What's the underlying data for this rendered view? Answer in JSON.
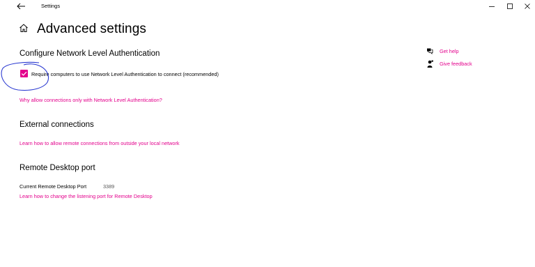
{
  "window": {
    "title": "Settings",
    "back_icon": "back-arrow-icon",
    "minimize_icon": "minimize-icon",
    "maximize_icon": "maximize-icon",
    "close_icon": "close-icon"
  },
  "page": {
    "title": "Advanced settings",
    "home_icon": "home-icon"
  },
  "nla": {
    "heading": "Configure Network Level Authentication",
    "checkbox_label": "Require computers to use Network Level Authentication to connect (recommended)",
    "checked": true,
    "link": "Why allow connections only with Network Level Authentication?"
  },
  "external": {
    "heading": "External connections",
    "link": "Learn how to allow remote connections from outside your local network"
  },
  "port": {
    "heading": "Remote Desktop port",
    "label": "Current Remote Desktop Port",
    "value": "3389",
    "link": "Learn how to change the listening port for Remote Desktop"
  },
  "side": {
    "get_help": "Get help",
    "give_feedback": "Give feedback",
    "help_icon": "chat-help-icon",
    "feedback_icon": "feedback-person-icon"
  },
  "colors": {
    "accent": "#e3008c",
    "annotation": "#2b3ad1"
  }
}
